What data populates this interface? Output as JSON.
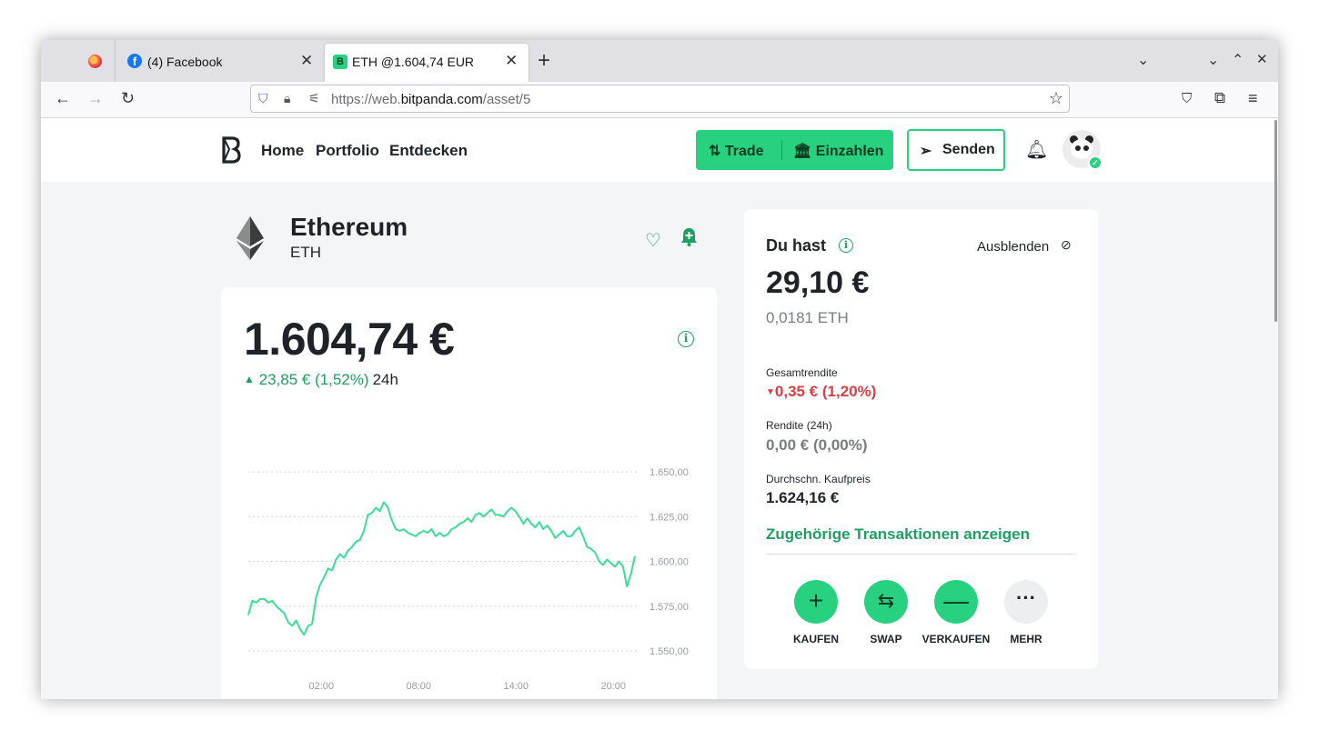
{
  "browser": {
    "tabs": [
      {
        "label": "(4) Facebook"
      },
      {
        "label": "ETH @1.604,74 EUR"
      }
    ],
    "url_prefix": "https://web.",
    "url_domain": "bitpanda.com",
    "url_path": "/asset/5"
  },
  "site": {
    "nav": {
      "home": "Home",
      "portfolio": "Portfolio",
      "explore": "Entdecken"
    },
    "buttons": {
      "trade": "Trade",
      "deposit": "Einzahlen",
      "send": "Senden"
    },
    "brand_color": "#27d17f",
    "accent_text_color": "#1e9f62",
    "negative_color": "#d64045"
  },
  "asset": {
    "name": "Ethereum",
    "symbol": "ETH",
    "price": "1.604,74 €",
    "change": "23,85 € (1,52%)",
    "change_period": "24h"
  },
  "holdings": {
    "title": "Du hast",
    "hide_label": "Ausblenden",
    "value": "29,10 €",
    "quantity": "0,0181 ETH",
    "total_return_label": "Gesamtrendite",
    "total_return_value": "0,35 € (1,20%)",
    "return_24h_label": "Rendite (24h)",
    "return_24h_value": "0,00 € (0,00%)",
    "avg_price_label": "Durchschn. Kaufpreis",
    "avg_price_value": "1.624,16 €",
    "transactions_link": "Zugehörige Transaktionen anzeigen",
    "actions": {
      "buy": "KAUFEN",
      "swap": "SWAP",
      "sell": "VERKAUFEN",
      "more": "MEHR"
    }
  },
  "chart_data": {
    "type": "line",
    "ylim": [
      1550,
      1650
    ],
    "yticks": [
      "1.650,00",
      "1.625,00",
      "1.600,00",
      "1.575,00",
      "1.550,00"
    ],
    "ytick_values": [
      1650,
      1625,
      1600,
      1575,
      1550
    ],
    "xticks": [
      "02:00",
      "08:00",
      "14:00",
      "20:00"
    ],
    "xtick_hours": [
      2,
      8,
      14,
      20
    ],
    "x_start_hour": -2.5,
    "x_end_hour": 21.5,
    "color": "#3ddc97",
    "series": [
      {
        "values": [
          1570,
          1578,
          1577,
          1579,
          1579,
          1577,
          1578,
          1575,
          1573,
          1571,
          1566,
          1564,
          1567,
          1562,
          1559,
          1564,
          1565,
          1580,
          1587,
          1591,
          1596,
          1595,
          1601,
          1604,
          1602,
          1606,
          1608,
          1611,
          1612,
          1617,
          1626,
          1627,
          1630,
          1628,
          1633,
          1630,
          1623,
          1618,
          1617,
          1618,
          1616,
          1615,
          1614,
          1616,
          1617,
          1616,
          1618,
          1614,
          1616,
          1614,
          1615,
          1618,
          1619,
          1621,
          1622,
          1624,
          1622,
          1626,
          1627,
          1625,
          1627,
          1629,
          1626,
          1626,
          1625,
          1628,
          1630,
          1628,
          1625,
          1621,
          1624,
          1621,
          1619,
          1622,
          1618,
          1620,
          1617,
          1613,
          1615,
          1617,
          1614,
          1614,
          1617,
          1619,
          1614,
          1608,
          1607,
          1605,
          1600,
          1598,
          1601,
          1599,
          1597,
          1600,
          1597,
          1586,
          1593,
          1603
        ]
      }
    ]
  }
}
